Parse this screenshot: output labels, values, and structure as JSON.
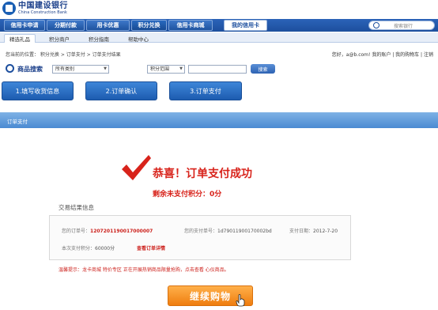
{
  "header": {
    "bank_name_cn": "中国建设银行",
    "bank_name_en": "China Construction Bank"
  },
  "mainnav": {
    "items": [
      "信用卡申请",
      "分期付款",
      "用卡优惠",
      "积分兑换",
      "信用卡商城"
    ],
    "my_card": "我的信用卡",
    "search_placeholder": "搜索银行"
  },
  "subnav": {
    "items": [
      "精选礼品",
      "积分商户",
      "积分指南",
      "帮助中心"
    ]
  },
  "breadcrumb": {
    "text": "您当前的位置： 积分兑换 > 订单支付 > 订单支付结果",
    "user_links": "您好，a@b.com!   我的账户 | 我的购物车 | 注销"
  },
  "goods_search": {
    "label": "商品搜索",
    "category": "所有类别",
    "points_range": "积分范围",
    "button": "搜索"
  },
  "steps": [
    "1.填写收货信息",
    "2.订单确认",
    "3.订单支付"
  ],
  "banner": {
    "title": "订单支付"
  },
  "result": {
    "title": "恭喜！订单支付成功",
    "remaining": "剩余未支付积分：0分"
  },
  "transaction": {
    "title": "交易结果信息",
    "order_label": "您的订单号：",
    "order_no": "1207201190017000007",
    "pay_label": "您的支付单号：",
    "pay_no": "1d79011900170002bd",
    "date_label": "支付日期：",
    "date": "2012-7-20",
    "points_label": "本次支付积分：",
    "points": "60000分",
    "detail_link": "查看订单详情"
  },
  "tip": "温馨提示：龙卡商城 特价专区 正在开展热销商品限量抢购，点击查看 心仪商品。",
  "continue_button": "继续购物"
}
